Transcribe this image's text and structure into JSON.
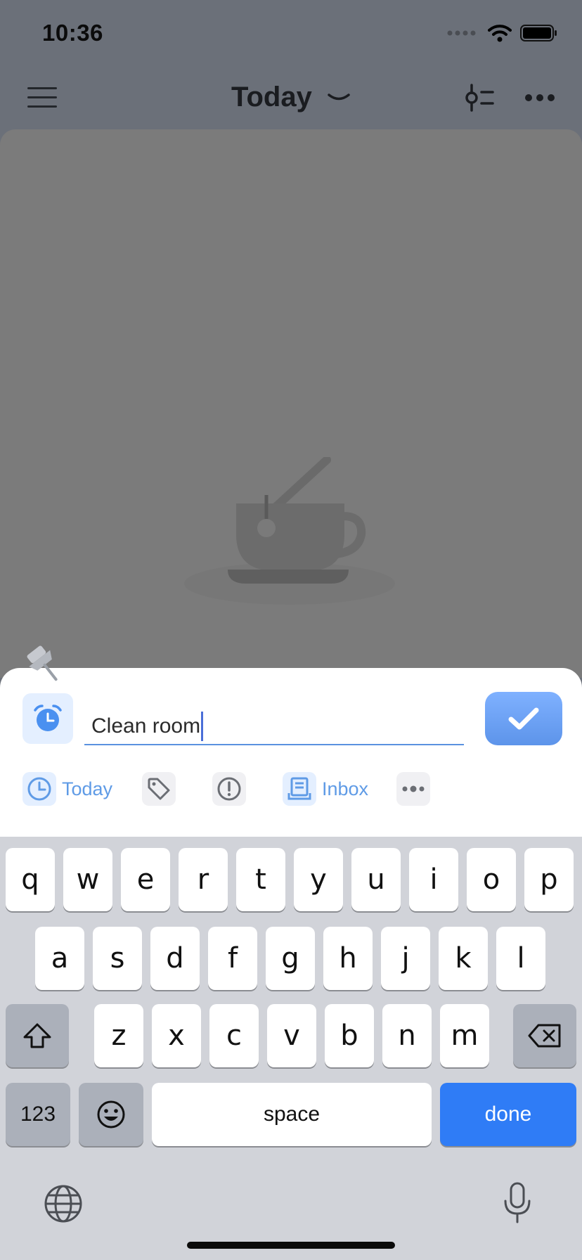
{
  "status_bar": {
    "time": "10:36"
  },
  "nav": {
    "title": "Today"
  },
  "quick_add": {
    "task_text": "Clean room",
    "chips": {
      "date_label": "Today",
      "list_label": "Inbox"
    }
  },
  "keyboard": {
    "row1": [
      "q",
      "w",
      "e",
      "r",
      "t",
      "y",
      "u",
      "i",
      "o",
      "p"
    ],
    "row2": [
      "a",
      "s",
      "d",
      "f",
      "g",
      "h",
      "j",
      "k",
      "l"
    ],
    "row3": [
      "z",
      "x",
      "c",
      "v",
      "b",
      "n",
      "m"
    ],
    "numbers_label": "123",
    "space_label": "space",
    "return_label": "done"
  },
  "colors": {
    "accent": "#5f9be6",
    "done_key": "#2f7cf6"
  }
}
